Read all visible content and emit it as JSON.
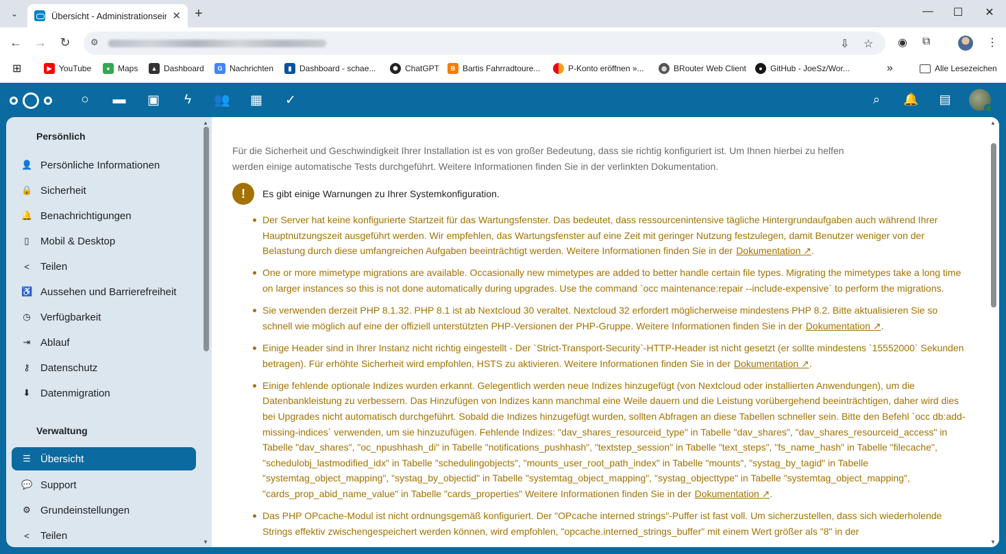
{
  "browser": {
    "tab_title": "Übersicht - Administrationseinst",
    "bookmarks": [
      {
        "label": "YouTube",
        "icon": "youtube-icon",
        "color": "#ff0000"
      },
      {
        "label": "Maps",
        "icon": "maps-icon",
        "color": "#34a853"
      },
      {
        "label": "Dashboard",
        "icon": "dashboard-icon",
        "color": "#333333"
      },
      {
        "label": "Nachrichten",
        "icon": "news-icon",
        "color": "#4285f4"
      },
      {
        "label": "Dashboard - schae...",
        "icon": "trello-icon",
        "color": "#0a52a0"
      },
      {
        "label": "ChatGPT",
        "icon": "chatgpt-icon",
        "color": "#222222"
      },
      {
        "label": "Bartis Fahrradtoure...",
        "icon": "blogger-icon",
        "color": "#f57d00"
      },
      {
        "label": "P-Konto eröffnen »...",
        "icon": "mastercard-icon",
        "color": "#eb001b"
      },
      {
        "label": "BRouter Web Client",
        "icon": "globe-icon",
        "color": "#555555"
      },
      {
        "label": "GitHub - JoeSz/Wor...",
        "icon": "github-icon",
        "color": "#181717"
      }
    ],
    "all_bookmarks_label": "Alle Lesezeichen"
  },
  "sidebar": {
    "personal_heading": "Persönlich",
    "personal_items": [
      {
        "label": "Persönliche Informationen",
        "icon": "person-icon"
      },
      {
        "label": "Sicherheit",
        "icon": "lock-icon"
      },
      {
        "label": "Benachrichtigungen",
        "icon": "bell-icon"
      },
      {
        "label": "Mobil & Desktop",
        "icon": "phone-icon"
      },
      {
        "label": "Teilen",
        "icon": "share-icon"
      },
      {
        "label": "Aussehen und Barrierefreiheit",
        "icon": "accessibility-icon"
      },
      {
        "label": "Verfügbarkeit",
        "icon": "clock-icon"
      },
      {
        "label": "Ablauf",
        "icon": "flow-icon"
      },
      {
        "label": "Datenschutz",
        "icon": "key-icon"
      },
      {
        "label": "Datenmigration",
        "icon": "download-icon"
      }
    ],
    "admin_heading": "Verwaltung",
    "admin_items": [
      {
        "label": "Übersicht",
        "icon": "list-icon",
        "active": true
      },
      {
        "label": "Support",
        "icon": "chat-icon"
      },
      {
        "label": "Grundeinstellungen",
        "icon": "gear-icon"
      },
      {
        "label": "Teilen",
        "icon": "share-icon"
      }
    ]
  },
  "content": {
    "intro": "Für die Sicherheit und Geschwindigkeit Ihrer Installation ist es von großer Bedeutung, dass sie richtig konfiguriert ist. Um Ihnen hierbei zu helfen werden einige automatische Tests durchgeführt. Weitere Informationen finden Sie in der verlinkten Dokumentation.",
    "warning_title": "Es gibt einige Warnungen zu Ihrer Systemkonfiguration.",
    "doc_link": "Dokumentation ↗",
    "warnings": [
      {
        "text": "Der Server hat keine konfigurierte Startzeit für das Wartungsfenster. Das bedeutet, dass ressourcenintensive tägliche Hintergrundaufgaben auch während Ihrer Hauptnutzungszeit ausgeführt werden. Wir empfehlen, das Wartungsfenster auf eine Zeit mit geringer Nutzung festzulegen, damit Benutzer weniger von der Belastung durch diese umfangreichen Aufgaben beeinträchtigt werden. Weitere Informationen finden Sie in der",
        "link": "Dokumentation ↗",
        "suffix": "."
      },
      {
        "text": "One or more mimetype migrations are available. Occasionally new mimetypes are added to better handle certain file types. Migrating the mimetypes take a long time on larger instances so this is not done automatically during upgrades. Use the command `occ maintenance:repair --include-expensive` to perform the migrations.",
        "link": "",
        "suffix": ""
      },
      {
        "text": "Sie verwenden derzeit PHP 8.1.32. PHP 8.1 ist ab Nextcloud 30 veraltet. Nextcloud 32 erfordert möglicherweise mindestens PHP 8.2. Bitte aktualisieren Sie so schnell wie möglich auf eine der offiziell unterstützten PHP-Versionen der PHP-Gruppe. Weitere Informationen finden Sie in der",
        "link": "Dokumentation ↗",
        "suffix": "."
      },
      {
        "text": "Einige Header sind in Ihrer Instanz nicht richtig eingestellt - Der `Strict-Transport-Security`-HTTP-Header ist nicht gesetzt (er sollte mindestens `15552000` Sekunden betragen). Für erhöhte Sicherheit wird empfohlen, HSTS zu aktivieren. Weitere Informationen finden Sie in der",
        "link": "Dokumentation ↗",
        "suffix": "."
      },
      {
        "text": "Einige fehlende optionale Indizes wurden erkannt. Gelegentlich werden neue Indizes hinzugefügt (von Nextcloud oder installierten Anwendungen), um die Datenbankleistung zu verbessern. Das Hinzufügen von Indizes kann manchmal eine Weile dauern und die Leistung vorübergehend beeinträchtigen, daher wird dies bei Upgrades nicht automatisch durchgeführt. Sobald die Indizes hinzugefügt wurden, sollten Abfragen an diese Tabellen schneller sein. Bitte den Befehl `occ db:add-missing-indices` verwenden, um sie hinzuzufügen. Fehlende Indizes: \"dav_shares_resourceid_type\" in Tabelle \"dav_shares\", \"dav_shares_resourceid_access\" in Tabelle \"dav_shares\", \"oc_npushhash_di\" in Tabelle \"notifications_pushhash\", \"textstep_session\" in Tabelle \"text_steps\", \"fs_name_hash\" in Tabelle \"filecache\", \"schedulobj_lastmodified_idx\" in Tabelle \"schedulingobjects\", \"mounts_user_root_path_index\" in Tabelle \"mounts\", \"systag_by_tagid\" in Tabelle \"systemtag_object_mapping\", \"systag_by_objectid\" in Tabelle \"systemtag_object_mapping\", \"systag_objecttype\" in Tabelle \"systemtag_object_mapping\", \"cards_prop_abid_name_value\" in Tabelle \"cards_properties\" Weitere Informationen finden Sie in der",
        "link": "Dokumentation ↗",
        "suffix": "."
      },
      {
        "text": "Das PHP OPcache-Modul ist nicht ordnungsgemäß konfiguriert. Der \"OPcache interned strings\"-Puffer ist fast voll. Um sicherzustellen, dass sich wiederholende Strings effektiv zwischengespeichert werden können, wird empfohlen, \"opcache.interned_strings_buffer\" mit einem Wert größer als \"8\" in der",
        "link": "",
        "suffix": ""
      }
    ]
  }
}
